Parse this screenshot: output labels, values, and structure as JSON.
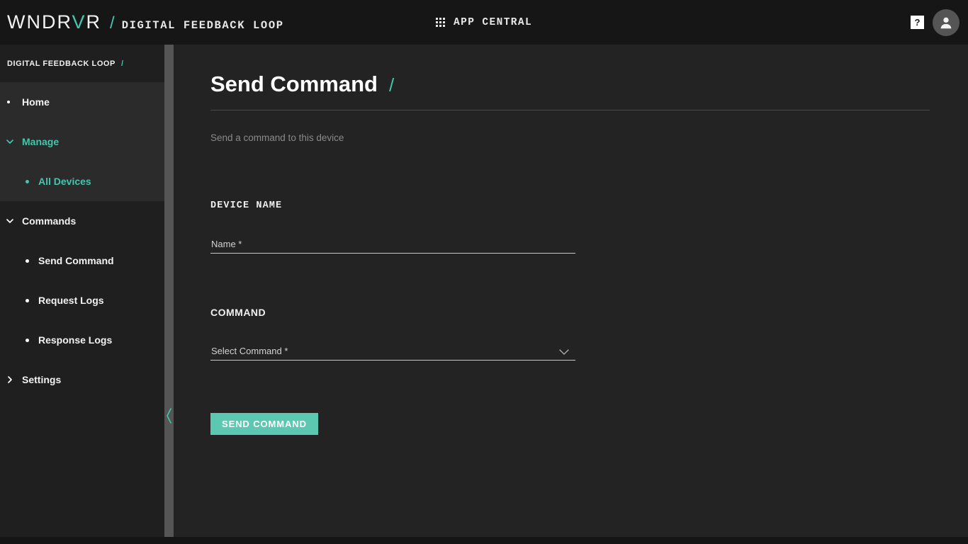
{
  "header": {
    "brand_main": "WNDRVR",
    "brand_highlight_letter": "V",
    "brand_slash": "/",
    "brand_subtitle": "DIGITAL FEEDBACK LOOP",
    "app_central_label": "APP CENTRAL",
    "app_central_icon": "grid-apps-icon",
    "help_label": "?",
    "help_icon": "help-question-icon",
    "avatar_icon": "user-account-icon"
  },
  "sidebar": {
    "breadcrumb": "DIGITAL FEEDBACK LOOP",
    "breadcrumb_slash": "/",
    "items": [
      {
        "label": "Home",
        "icon": "bullet-icon",
        "active": false
      },
      {
        "label": "Manage",
        "icon": "chevron-down-icon",
        "active": true
      },
      {
        "label": "All Devices",
        "icon": "bullet-icon",
        "active": true
      },
      {
        "label": "Commands",
        "icon": "chevron-down-icon",
        "active": false
      },
      {
        "label": "Send Command",
        "icon": "bullet-icon",
        "active": false
      },
      {
        "label": "Request Logs",
        "icon": "bullet-icon",
        "active": false
      },
      {
        "label": "Response Logs",
        "icon": "bullet-icon",
        "active": false
      },
      {
        "label": "Settings",
        "icon": "chevron-right-icon",
        "active": false
      }
    ],
    "collapse_handle_icon": "chevron-left-icon"
  },
  "main": {
    "title": "Send Command",
    "title_slash": "/",
    "subtitle": "Send a command to this device",
    "sections": [
      {
        "label": "DEVICE NAME",
        "field_label": "Name *",
        "field_value": "",
        "field_placeholder": "Name *",
        "field_type": "text"
      },
      {
        "label": "COMMAND",
        "field_label": "Select Command *",
        "field_value": "",
        "field_placeholder": "Select Command *",
        "field_type": "select",
        "field_icon": "chevron-down-icon"
      }
    ],
    "submit_label": "SEND COMMAND"
  },
  "colors": {
    "accent": "#43c6ac",
    "button": "#5cc8b2",
    "background": "#232323",
    "sidebar": "#1f1f1f",
    "sidebar_active": "#2b2b2b",
    "topbar": "#161616",
    "rail": "#555555"
  }
}
